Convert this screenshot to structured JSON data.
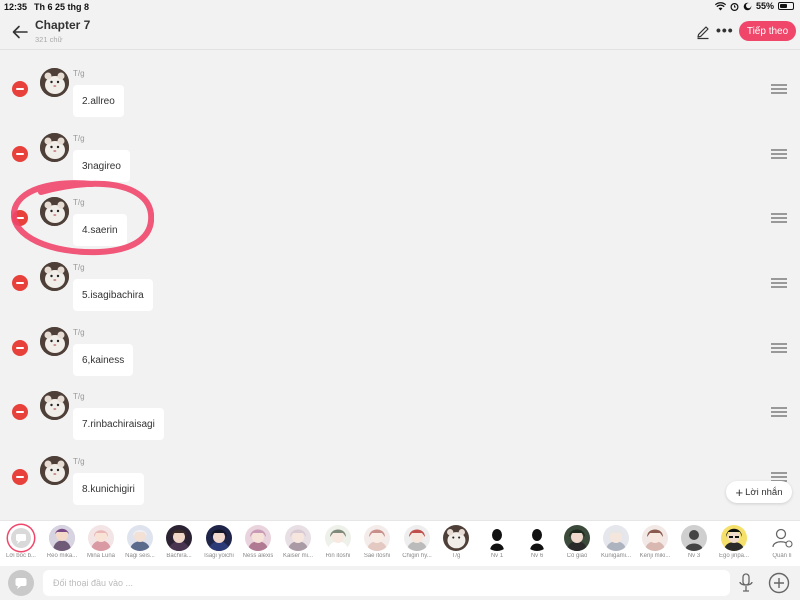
{
  "status_bar": {
    "time": "12:35",
    "date": "Th 6 25 thg 8",
    "battery": "55%",
    "battery_level": 0.55
  },
  "header": {
    "title": "Chapter 7",
    "subtitle": "321 chữ",
    "next_label": "Tiếp theo",
    "more_label": "•••"
  },
  "messages": [
    {
      "name": "T/g",
      "text": "2.allreo"
    },
    {
      "name": "T/g",
      "text": "3nagireo"
    },
    {
      "name": "T/g",
      "text": "4.saerin"
    },
    {
      "name": "T/g",
      "text": "5.isagibachira"
    },
    {
      "name": "T/g",
      "text": "6,kainess"
    },
    {
      "name": "T/g",
      "text": "7.rinbachiraisagi"
    },
    {
      "name": "T/g",
      "text": "8.kunichigiri"
    }
  ],
  "add_message_label": "Lời nhắn",
  "characters": [
    {
      "label": "Lời bốc b..."
    },
    {
      "label": "Reo mika..."
    },
    {
      "label": "Mina Luna"
    },
    {
      "label": "Nagi seis..."
    },
    {
      "label": "Bachira..."
    },
    {
      "label": "Isagi yoichi"
    },
    {
      "label": "Ness alexis"
    },
    {
      "label": "Kaiser mi..."
    },
    {
      "label": "Rin itoshi"
    },
    {
      "label": "Sae itoshi"
    },
    {
      "label": "Chigiri hy..."
    },
    {
      "label": "T/g"
    },
    {
      "label": "Nv 1"
    },
    {
      "label": "Nv 6"
    },
    {
      "label": "Cô giáo"
    },
    {
      "label": "Kunigami..."
    },
    {
      "label": "Kenji miki..."
    },
    {
      "label": "Nv 3"
    },
    {
      "label": "Ego jinpa..."
    }
  ],
  "manage_label": "Quản lí",
  "input": {
    "placeholder": "Đối thoại đầu vào ..."
  },
  "colors": {
    "accent": "#f0466a",
    "remove": "#e8413b",
    "circle_mark": "#f0466a"
  }
}
